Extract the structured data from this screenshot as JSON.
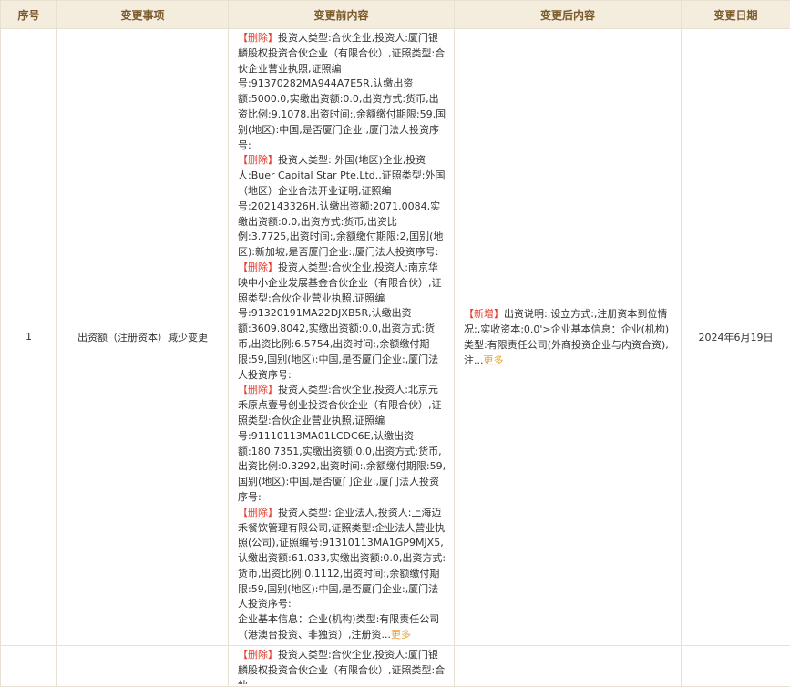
{
  "columns": [
    "序号",
    "变更事项",
    "变更前内容",
    "变更后内容",
    "变更日期"
  ],
  "rows": [
    {
      "index": "1",
      "item": "出资额（注册资本）减少变更",
      "date": "2024年6月19日",
      "before": {
        "b1_tag": "【删除】",
        "b1": "投资人类型:合伙企业,投资人:厦门银麟股权投资合伙企业（有限合伙）,证照类型:合伙企业营业执照,证照编号:91370282MA944A7E5R,认缴出资额:5000.0,实缴出资额:0.0,出资方式:货币,出资比例:9.1078,出资时间:,余额缴付期限:59,国别(地区):中国,是否厦门企业:,厦门法人投资序号:",
        "b2_tag": "【删除】",
        "b2": "投资人类型: 外国(地区)企业,投资人:Buer Capital Star Pte.Ltd.,证照类型:外国（地区）企业合法开业证明,证照编号:202143326H,认缴出资额:2071.0084,实缴出资额:0.0,出资方式:货币,出资比例:3.7725,出资时间:,余额缴付期限:2,国别(地区):新加坡,是否厦门企业:,厦门法人投资序号:",
        "b3_tag": "【删除】",
        "b3": "投资人类型:合伙企业,投资人:南京华映中小企业发展基金合伙企业（有限合伙）,证照类型:合伙企业营业执照,证照编号:91320191MA22DJXB5R,认缴出资额:3609.8042,实缴出资额:0.0,出资方式:货币,出资比例:6.5754,出资时间:,余额缴付期限:59,国别(地区):中国,是否厦门企业:,厦门法人投资序号:",
        "b4_tag": "【删除】",
        "b4": "投资人类型:合伙企业,投资人:北京元禾原点壹号创业投资合伙企业（有限合伙）,证照类型:合伙企业营业执照,证照编号:91110113MA01LCDC6E,认缴出资额:180.7351,实缴出资额:0.0,出资方式:货币,出资比例:0.3292,出资时间:,余额缴付期限:59,国别(地区):中国,是否厦门企业:,厦门法人投资序号:",
        "b5_tag": "【删除】",
        "b5": "投资人类型: 企业法人,投资人:上海迈禾餐饮管理有限公司,证照类型:企业法人营业执照(公司),证照编号:91310113MA1GP9MJX5,认缴出资额:61.033,实缴出资额:0.0,出资方式:货币,出资比例:0.1112,出资时间:,余额缴付期限:59,国别(地区):中国,是否厦门企业:,厦门法人投资序号:",
        "tail": "企业基本信息：企业(机构)类型:有限责任公司（港澳台投资、非独资）,注册资...",
        "more": "更多"
      },
      "after": {
        "tag": "【新增】",
        "text": "出资说明:,设立方式:,注册资本到位情况:,实收资本:0.0'>企业基本信息：企业(机构)类型:有限责任公司(外商投资企业与内资合资),注...",
        "more": "更多"
      }
    },
    {
      "before_partial_tag": "【删除】",
      "before_partial": "投资人类型:合伙企业,投资人:厦门银麟股权投资合伙企业（有限合伙）,证照类型:合伙"
    }
  ]
}
